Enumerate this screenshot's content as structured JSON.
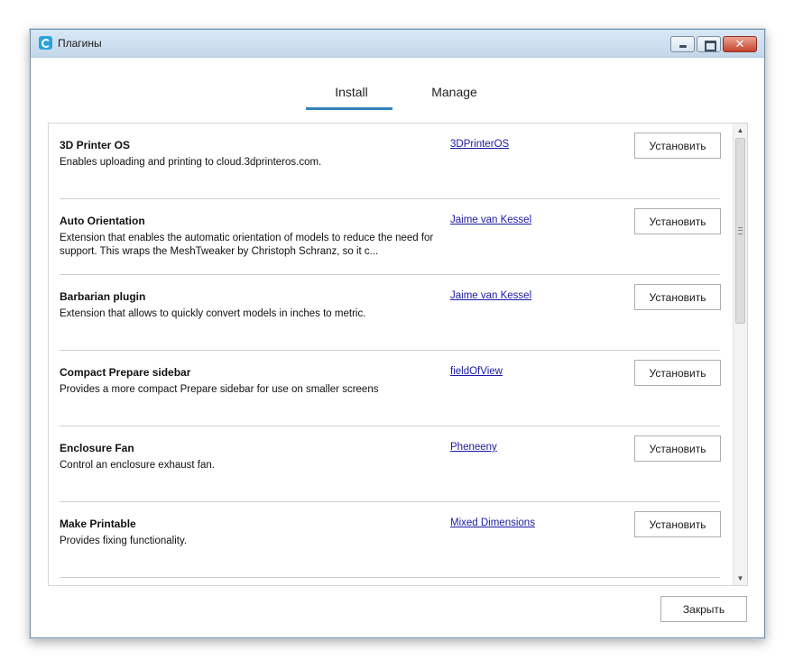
{
  "window": {
    "title": "Плагины"
  },
  "tabs": [
    {
      "label": "Install",
      "active": true
    },
    {
      "label": "Manage",
      "active": false
    }
  ],
  "plugins": [
    {
      "name": "3D Printer OS",
      "description": "Enables uploading and printing to cloud.3dprinteros.com.",
      "author": "3DPrinterOS",
      "button": "Установить"
    },
    {
      "name": "Auto Orientation",
      "description": "Extension that enables the automatic orientation of models to reduce the need for support. This wraps the MeshTweaker by Christoph Schranz, so it c...",
      "author": "Jaime van Kessel",
      "button": "Установить"
    },
    {
      "name": "Barbarian plugin",
      "description": "Extension that allows to quickly convert models in inches to metric.",
      "author": "Jaime van Kessel",
      "button": "Установить"
    },
    {
      "name": "Compact Prepare sidebar",
      "description": "Provides a more compact Prepare sidebar for use on smaller screens",
      "author": "fieldOfView",
      "button": "Установить"
    },
    {
      "name": "Enclosure Fan",
      "description": "Control an enclosure exhaust fan.",
      "author": "Pheneeny",
      "button": "Установить"
    },
    {
      "name": "Make Printable",
      "description": "Provides fixing functionality.",
      "author": "Mixed Dimensions",
      "button": "Установить"
    }
  ],
  "footer": {
    "close_label": "Закрыть"
  },
  "colors": {
    "accent": "#3282be",
    "link": "#1a1aa6"
  },
  "icons": {
    "app": "cura-logo-icon",
    "minimize": "minimize-icon",
    "maximize": "maximize-icon",
    "close": "close-icon",
    "scroll_up": "chevron-up-icon",
    "scroll_down": "chevron-down-icon"
  }
}
